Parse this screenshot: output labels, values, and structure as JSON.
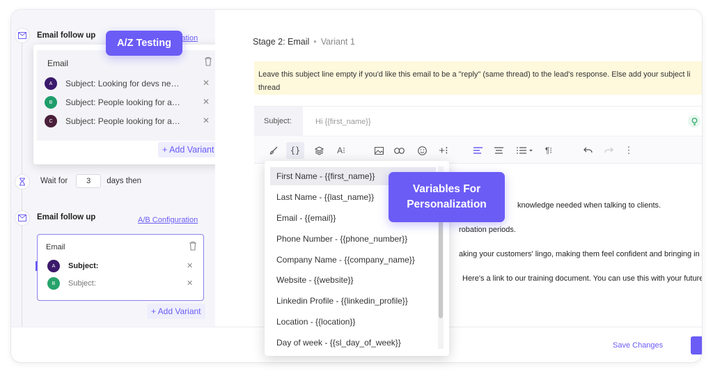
{
  "sidebar": {
    "step1": {
      "title": "Email follow up",
      "ab_link": "A/B Configuration",
      "card_title": "Email",
      "variants": [
        {
          "letter": "A",
          "subject": "Subject: Looking for devs nee…",
          "color": "#3b1a6b"
        },
        {
          "letter": "B",
          "subject": "Subject: People looking for ap…",
          "color": "#1f9d6a"
        },
        {
          "letter": "C",
          "subject": "Subject: People looking for ap…",
          "color": "#4a1f3a"
        }
      ],
      "add_variant": "+ Add Variant"
    },
    "wait": {
      "prefix": "Wait for",
      "value": "3",
      "suffix": "days then"
    },
    "step2": {
      "title": "Email follow up",
      "ab_link": "A/B Configuration",
      "card_title": "Email",
      "variants": [
        {
          "letter": "A",
          "subject": "Subject:",
          "color": "#3b1a6b"
        },
        {
          "letter": "B",
          "subject": "Subject:",
          "color": "#27a36a"
        }
      ],
      "add_variant": "+ Add Variant"
    }
  },
  "main": {
    "stage": "Stage 2: Email",
    "dot": "•",
    "variant": "Variant 1",
    "notice": "Leave this subject line empty if you'd like this email to be a \"reply\" (same thread) to the lead's response. Else add your subject li thread",
    "subject_label": "Subject:",
    "subject_placeholder": "Hi {{first_name}}",
    "body_lines": [
      "knowledge needed when talking to clients.",
      "robation periods.",
      "aking your customers' lingo, making them feel confident and bringing in the",
      "Here's a link to our training document. You can use this with your future SD"
    ]
  },
  "dropdown": {
    "items": [
      "First Name - {{first_name}}",
      "Last Name - {{last_name}}",
      "Email - {{email}}",
      "Phone Number - {{phone_number}}",
      "Company Name - {{company_name}}",
      "Website - {{website}}",
      "Linkedin Profile - {{linkedin_profile}}",
      "Location - {{location}}",
      "Day of week - {{sl_day_of_week}}"
    ]
  },
  "callouts": {
    "az": "A/Z Testing",
    "variables_line1": "Variables For",
    "variables_line2": "Personalization"
  },
  "footer": {
    "save": "Save Changes"
  },
  "colors": {
    "accent": "#6b5cf6",
    "notice_bg": "#fef8dc"
  }
}
